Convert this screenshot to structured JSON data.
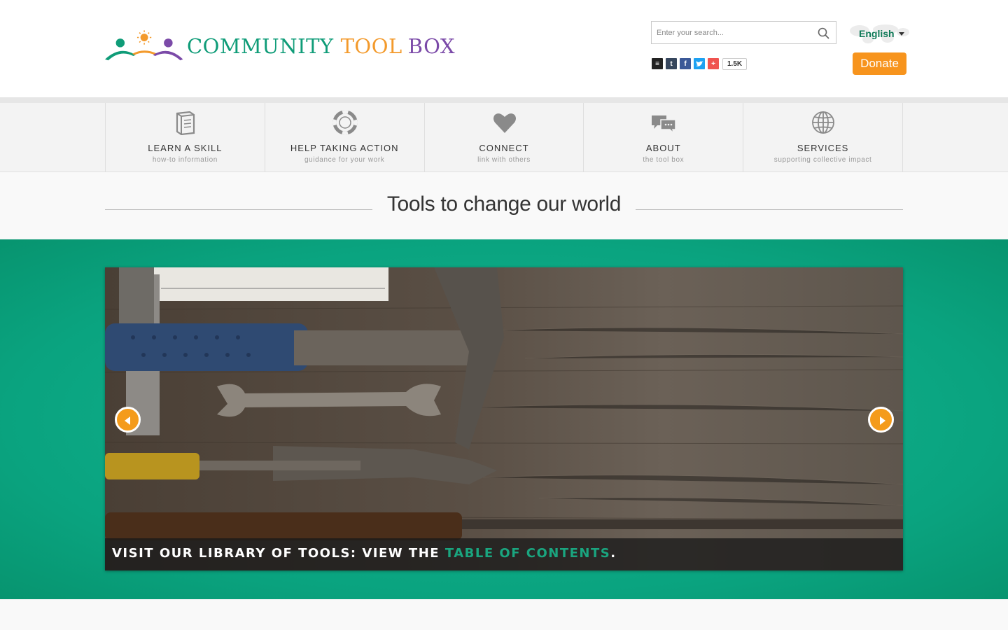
{
  "header": {
    "logo": {
      "word1": "COMMUNITY",
      "word2": "TOOL",
      "word3": "BOX"
    },
    "search": {
      "placeholder": "Enter your search..."
    },
    "share": {
      "count": "1.5K",
      "icons": [
        "buffer-icon",
        "tumblr-icon",
        "facebook-icon",
        "twitter-icon",
        "plus-icon"
      ]
    },
    "language": {
      "label": "English"
    },
    "donate_label": "Donate"
  },
  "nav": {
    "items": [
      {
        "title": "LEARN A SKILL",
        "sub": "how-to information",
        "icon": "book-icon"
      },
      {
        "title": "HELP TAKING ACTION",
        "sub": "guidance for your work",
        "icon": "lifebuoy-icon"
      },
      {
        "title": "CONNECT",
        "sub": "link with others",
        "icon": "heart-icon"
      },
      {
        "title": "ABOUT",
        "sub": "the tool box",
        "icon": "chat-bubbles-icon"
      },
      {
        "title": "SERVICES",
        "sub": "supporting collective impact",
        "icon": "globe-icon"
      }
    ]
  },
  "tagline": "Tools to change our world",
  "hero": {
    "caption_prefix": "VISIT OUR LIBRARY OF TOOLS: VIEW THE ",
    "caption_link": "TABLE OF CONTENTS",
    "caption_suffix": "."
  },
  "colors": {
    "brand_green": "#0f9c78",
    "brand_orange": "#f39a2c",
    "brand_purple": "#7b4aa8",
    "hero_green": "#0ea884",
    "donate": "#f7941d"
  }
}
